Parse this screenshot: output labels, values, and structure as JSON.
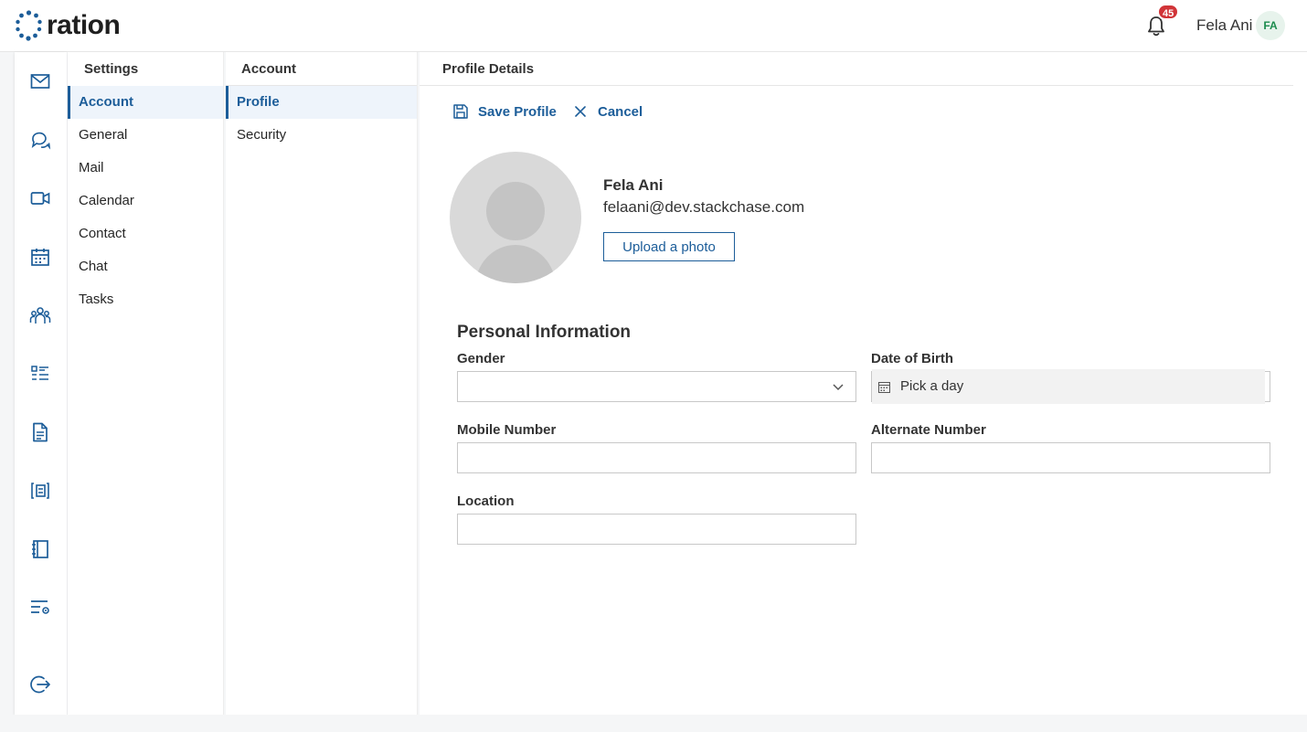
{
  "app": {
    "logo_text": "ration",
    "notification_count": "45",
    "user_name": "Fela Ani",
    "user_initials": "FA",
    "brand_color": "#1c5d99"
  },
  "rail": {
    "icons": [
      "mail-icon",
      "chat-icon",
      "video-icon",
      "calendar-icon",
      "contacts-icon",
      "tasks-icon",
      "document-icon",
      "board-icon",
      "notebook-icon",
      "settings-list-icon",
      "logout-icon"
    ]
  },
  "settings_nav": {
    "title": "Settings",
    "items": [
      {
        "label": "Account",
        "active": true
      },
      {
        "label": "General",
        "active": false
      },
      {
        "label": "Mail",
        "active": false
      },
      {
        "label": "Calendar",
        "active": false
      },
      {
        "label": "Contact",
        "active": false
      },
      {
        "label": "Chat",
        "active": false
      },
      {
        "label": "Tasks",
        "active": false
      }
    ]
  },
  "account_nav": {
    "title": "Account",
    "items": [
      {
        "label": "Profile",
        "active": true
      },
      {
        "label": "Security",
        "active": false
      }
    ]
  },
  "profile": {
    "title": "Profile Details",
    "save_label": "Save Profile",
    "cancel_label": "Cancel",
    "name": "Fela Ani",
    "email": "felaani@dev.stackchase.com",
    "upload_label": "Upload a photo"
  },
  "personal_info": {
    "title": "Personal Information",
    "gender_label": "Gender",
    "gender_value": "",
    "dob_label": "Date of Birth",
    "dob_placeholder": "Pick a day",
    "mobile_label": "Mobile Number",
    "mobile_value": "",
    "alternate_label": "Alternate Number",
    "alternate_value": "",
    "location_label": "Location",
    "location_value": ""
  }
}
